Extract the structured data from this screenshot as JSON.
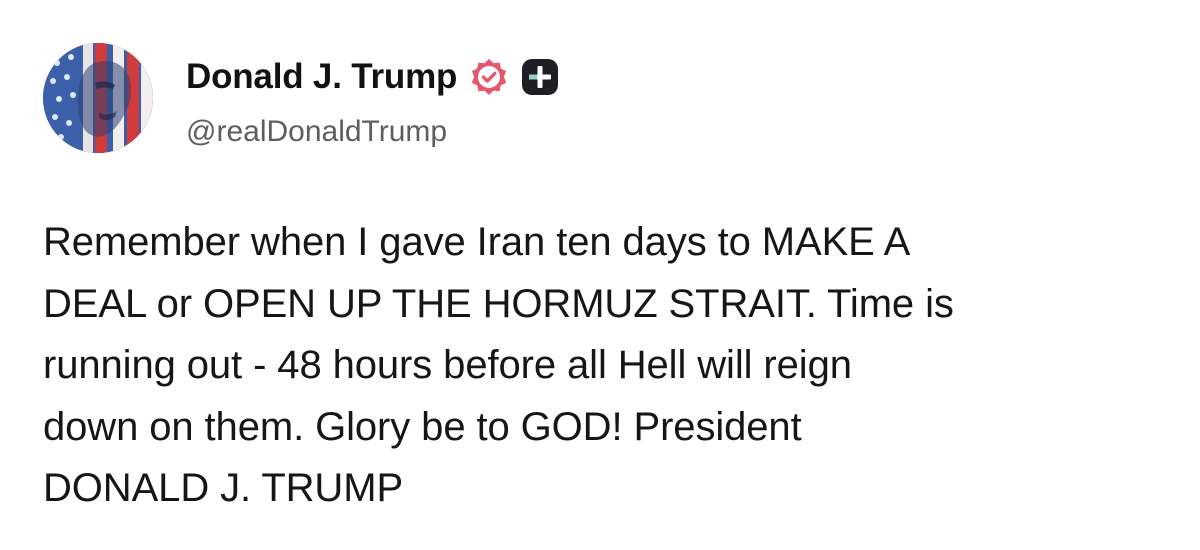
{
  "author": {
    "name": "Donald J. Trump",
    "handle": "@realDonaldTrump",
    "avatar_icon": "american-flag-portrait-avatar",
    "verified_icon": "verified-badge-icon",
    "verified_color": "#e8566b",
    "plus_icon": "plus-badge-icon"
  },
  "post": {
    "lines": [
      "Remember when I gave Iran ten days to MAKE A",
      "DEAL or OPEN UP THE HORMUZ STRAIT. Time is",
      "running out - 48 hours before all Hell will reign",
      "down on them. Glory be to GOD! President",
      "DONALD J. TRUMP"
    ]
  },
  "colors": {
    "background": "#ffffff",
    "text": "#161616",
    "handle": "#5e5e5e"
  }
}
